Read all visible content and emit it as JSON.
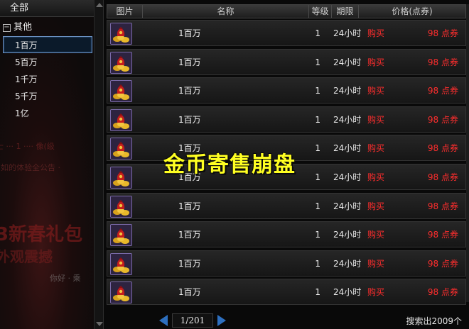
{
  "sidebar": {
    "all_label": "全部",
    "group_label": "其他",
    "items": [
      "1百万",
      "5百万",
      "1千万",
      "5千万",
      "1亿"
    ],
    "selected_index": 0
  },
  "table": {
    "headers": {
      "image": "图片",
      "name": "名称",
      "level": "等级",
      "time_limit": "期限",
      "price": "价格(点券)"
    },
    "rows": [
      {
        "name": "1百万",
        "level": "1",
        "time_limit": "24小时",
        "buy": "购买",
        "price": "98 点券"
      },
      {
        "name": "1百万",
        "level": "1",
        "time_limit": "24小时",
        "buy": "购买",
        "price": "98 点券"
      },
      {
        "name": "1百万",
        "level": "1",
        "time_limit": "24小时",
        "buy": "购买",
        "price": "98 点券"
      },
      {
        "name": "1百万",
        "level": "1",
        "time_limit": "24小时",
        "buy": "购买",
        "price": "98 点券"
      },
      {
        "name": "1百万",
        "level": "1",
        "time_limit": "24小时",
        "buy": "购买",
        "price": "98 点券"
      },
      {
        "name": "1百万",
        "level": "1",
        "time_limit": "24小时",
        "buy": "购买",
        "price": "98 点券"
      },
      {
        "name": "1百万",
        "level": "1",
        "time_limit": "24小时",
        "buy": "购买",
        "price": "98 点券"
      },
      {
        "name": "1百万",
        "level": "1",
        "time_limit": "24小时",
        "buy": "购买",
        "price": "98 点券"
      },
      {
        "name": "1百万",
        "level": "1",
        "time_limit": "24小时",
        "buy": "购买",
        "price": "98 点券"
      },
      {
        "name": "1百万",
        "level": "1",
        "time_limit": "24小时",
        "buy": "购买",
        "price": "98 点券"
      }
    ],
    "item_icon": "gold-coin-bag-icon"
  },
  "pager": {
    "page_text": "1/201",
    "result_count": "搜索出2009个"
  },
  "overlay_caption": "金币寄售崩盘",
  "colors": {
    "buy_red": "#ff2d2d",
    "overlay_yellow": "#ffff22",
    "pager_blue": "#2d6fbf",
    "selected_border": "#6c93c4"
  }
}
